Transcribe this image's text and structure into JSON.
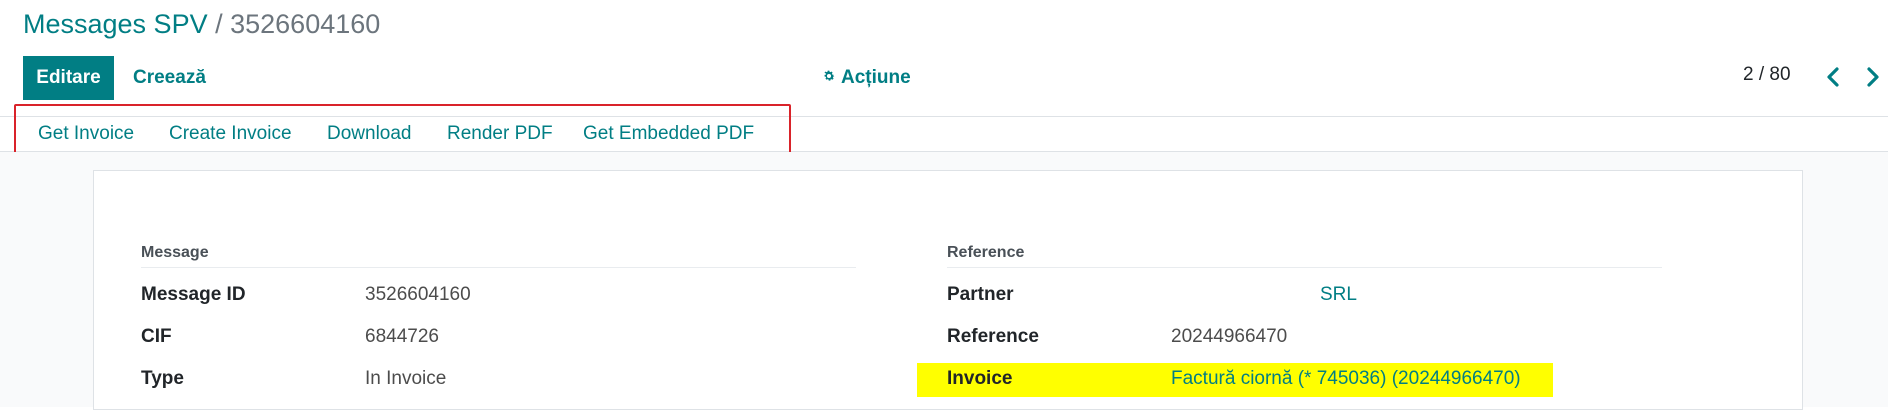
{
  "breadcrumb": {
    "parent": "Messages SPV",
    "separator": " / ",
    "current": "3526604160"
  },
  "toolbar": {
    "edit_label": "Editare",
    "create_label": "Creează",
    "action_label": "Acțiune",
    "action_icon": "gear-icon"
  },
  "pager": {
    "value": "2 / 80",
    "prev_icon": "chevron-left-icon",
    "next_icon": "chevron-right-icon"
  },
  "statusbar": {
    "buttons": [
      "Get Invoice",
      "Create Invoice",
      "Download",
      "Render PDF",
      "Get Embedded PDF"
    ]
  },
  "message_group": {
    "title": "Message",
    "fields": [
      {
        "label": "Message ID",
        "value": "3526604160"
      },
      {
        "label": "CIF",
        "value": "6844726"
      },
      {
        "label": "Type",
        "value": "In Invoice"
      }
    ]
  },
  "reference_group": {
    "title": "Reference",
    "fields": [
      {
        "label": "Partner",
        "value": "SRL"
      },
      {
        "label": "Reference",
        "value": "20244966470"
      },
      {
        "label": "Invoice",
        "value": "Factură ciornă (* 745036) (20244966470)"
      }
    ]
  },
  "colors": {
    "brand": "#017e84",
    "highlight_box": "#d9232a",
    "highlight_field": "#ffff00"
  }
}
